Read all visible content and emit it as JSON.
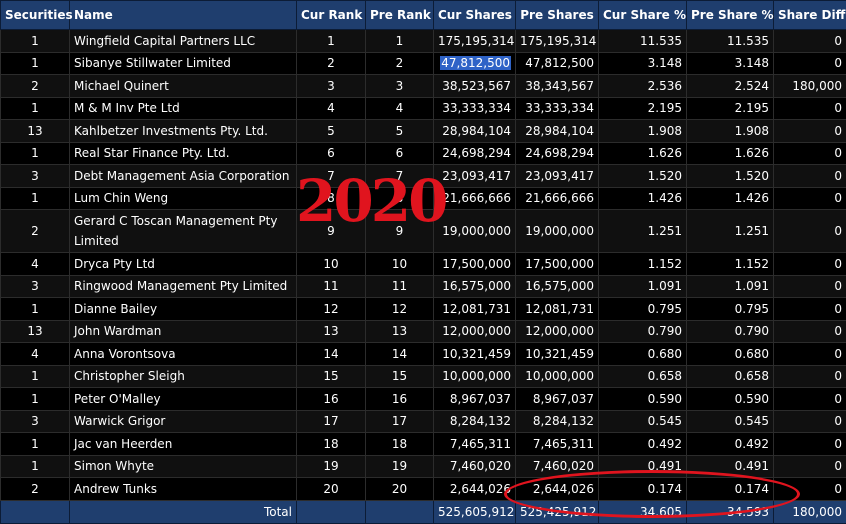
{
  "columns": [
    "Securities",
    "Name",
    "Cur Rank",
    "Pre Rank",
    "Cur Shares",
    "Pre Shares",
    "Cur Share %",
    "Pre Share %",
    "Share Diff"
  ],
  "rows": [
    [
      "1",
      "Wingfield Capital Partners LLC",
      "1",
      "1",
      "175,195,314",
      "175,195,314",
      "11.535",
      "11.535",
      "0"
    ],
    [
      "1",
      "Sibanye Stillwater Limited",
      "2",
      "2",
      "47,812,500",
      "47,812,500",
      "3.148",
      "3.148",
      "0"
    ],
    [
      "2",
      "Michael Quinert",
      "3",
      "3",
      "38,523,567",
      "38,343,567",
      "2.536",
      "2.524",
      "180,000"
    ],
    [
      "1",
      "M & M Inv Pte Ltd",
      "4",
      "4",
      "33,333,334",
      "33,333,334",
      "2.195",
      "2.195",
      "0"
    ],
    [
      "13",
      "Kahlbetzer Investments Pty. Ltd.",
      "5",
      "5",
      "28,984,104",
      "28,984,104",
      "1.908",
      "1.908",
      "0"
    ],
    [
      "1",
      "Real Star Finance Pty. Ltd.",
      "6",
      "6",
      "24,698,294",
      "24,698,294",
      "1.626",
      "1.626",
      "0"
    ],
    [
      "3",
      "Debt Management Asia Corporation",
      "7",
      "7",
      "23,093,417",
      "23,093,417",
      "1.520",
      "1.520",
      "0"
    ],
    [
      "1",
      "Lum Chin Weng",
      "8",
      "8",
      "21,666,666",
      "21,666,666",
      "1.426",
      "1.426",
      "0"
    ],
    [
      "2",
      "Gerard C Toscan Management Pty Limited",
      "9",
      "9",
      "19,000,000",
      "19,000,000",
      "1.251",
      "1.251",
      "0"
    ],
    [
      "4",
      "Dryca Pty Ltd",
      "10",
      "10",
      "17,500,000",
      "17,500,000",
      "1.152",
      "1.152",
      "0"
    ],
    [
      "3",
      "Ringwood Management Pty Limited",
      "11",
      "11",
      "16,575,000",
      "16,575,000",
      "1.091",
      "1.091",
      "0"
    ],
    [
      "1",
      "Dianne Bailey",
      "12",
      "12",
      "12,081,731",
      "12,081,731",
      "0.795",
      "0.795",
      "0"
    ],
    [
      "13",
      "John Wardman",
      "13",
      "13",
      "12,000,000",
      "12,000,000",
      "0.790",
      "0.790",
      "0"
    ],
    [
      "4",
      "Anna Vorontsova",
      "14",
      "14",
      "10,321,459",
      "10,321,459",
      "0.680",
      "0.680",
      "0"
    ],
    [
      "1",
      "Christopher Sleigh",
      "15",
      "15",
      "10,000,000",
      "10,000,000",
      "0.658",
      "0.658",
      "0"
    ],
    [
      "1",
      "Peter O'Malley",
      "16",
      "16",
      "8,967,037",
      "8,967,037",
      "0.590",
      "0.590",
      "0"
    ],
    [
      "3",
      "Warwick Grigor",
      "17",
      "17",
      "8,284,132",
      "8,284,132",
      "0.545",
      "0.545",
      "0"
    ],
    [
      "1",
      "Jac van Heerden",
      "18",
      "18",
      "7,465,311",
      "7,465,311",
      "0.492",
      "0.492",
      "0"
    ],
    [
      "1",
      "Simon Whyte",
      "19",
      "19",
      "7,460,020",
      "7,460,020",
      "0.491",
      "0.491",
      "0"
    ],
    [
      "2",
      "Andrew Tunks",
      "20",
      "20",
      "2,644,026",
      "2,644,026",
      "0.174",
      "0.174",
      "0"
    ]
  ],
  "total": {
    "label": "Total",
    "cur_shares": "525,605,912",
    "pre_shares": "525,425,912",
    "cur_share_pct": "34.605",
    "pre_share_pct": "34.593",
    "share_diff": "180,000"
  },
  "selected_cell": {
    "row": 1,
    "col": 4
  },
  "annotation": {
    "year": "2020",
    "color": "#e0141e"
  },
  "colors": {
    "header_bg": "#1f3e6e",
    "selection": "#2f63c7"
  }
}
